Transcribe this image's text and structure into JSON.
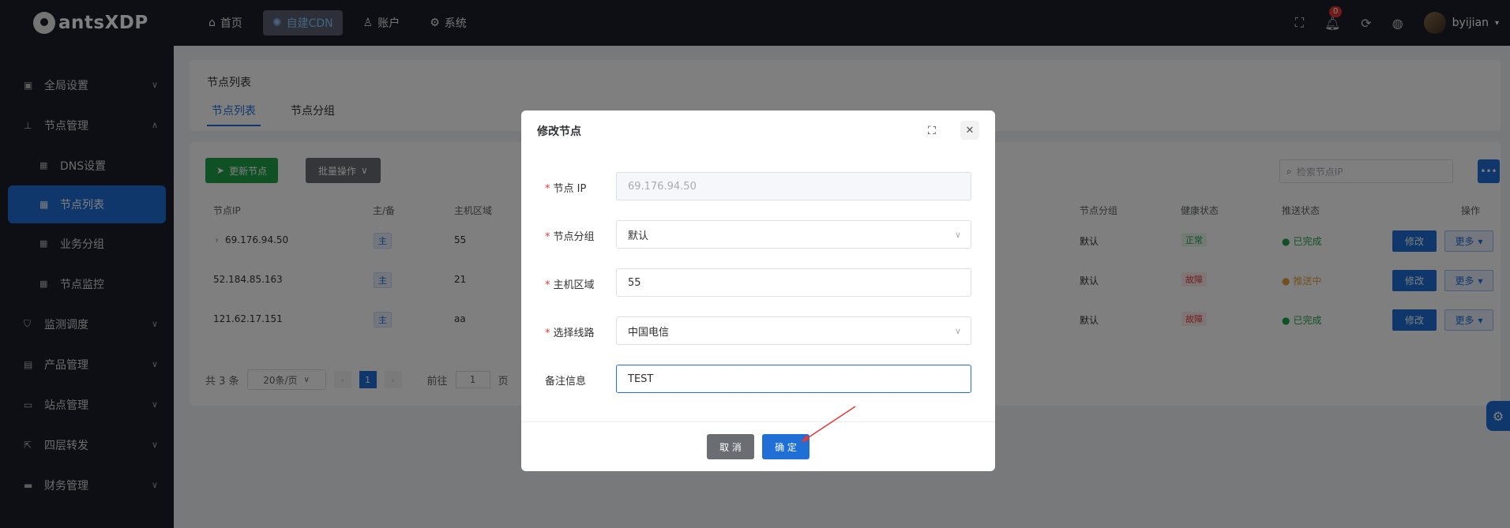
{
  "app": {
    "logo_text": "antsXDP"
  },
  "topnav": [
    {
      "icon": "home-icon",
      "glyph": "⌂",
      "label": "首页"
    },
    {
      "icon": "cdn-icon",
      "glyph": "✺",
      "label": "自建CDN"
    },
    {
      "icon": "user-icon",
      "glyph": "♙",
      "label": "账户"
    },
    {
      "icon": "gear-icon",
      "glyph": "⚙",
      "label": "系统"
    }
  ],
  "topright": {
    "notification_count": "0",
    "username": "byijian"
  },
  "sidebar": {
    "items": [
      {
        "label": "全局设置"
      },
      {
        "label": "节点管理"
      },
      {
        "label": "DNS设置"
      },
      {
        "label": "节点列表"
      },
      {
        "label": "业务分组"
      },
      {
        "label": "节点监控"
      },
      {
        "label": "监测调度"
      },
      {
        "label": "产品管理"
      },
      {
        "label": "站点管理"
      },
      {
        "label": "四层转发"
      },
      {
        "label": "财务管理"
      }
    ]
  },
  "page": {
    "title": "节点列表",
    "tabs": [
      {
        "label": "节点列表"
      },
      {
        "label": "节点分组"
      }
    ]
  },
  "toolbar": {
    "update_label": "更新节点",
    "batch_label": "批量操作",
    "search_placeholder": "检索节点IP"
  },
  "table": {
    "headers": {
      "ip": "节点IP",
      "role": "主/备",
      "region": "主机区域",
      "group": "节点分组",
      "health": "健康状态",
      "push": "推送状态",
      "ops": "操作"
    },
    "rows": [
      {
        "ip": "69.176.94.50",
        "role": "主",
        "region": "55",
        "group": "默认",
        "health": "正常",
        "push": "已完成",
        "edit": "修改",
        "more": "更多"
      },
      {
        "ip": "52.184.85.163",
        "role": "主",
        "region": "21",
        "group": "默认",
        "health": "故障",
        "push": "推送中",
        "edit": "修改",
        "more": "更多"
      },
      {
        "ip": "121.62.17.151",
        "role": "主",
        "region": "aa",
        "group": "默认",
        "health": "故障",
        "push": "已完成",
        "edit": "修改",
        "more": "更多"
      }
    ]
  },
  "pager": {
    "total": "共 3 条",
    "page_size": "20条/页",
    "current": "1",
    "goto_prefix": "前往",
    "goto_value": "1",
    "goto_suffix": "页"
  },
  "dialog": {
    "title": "修改节点",
    "fields": [
      {
        "label": "节点 IP",
        "required": true,
        "value": "69.176.94.50"
      },
      {
        "label": "节点分组",
        "required": true,
        "value": "默认"
      },
      {
        "label": "主机区域",
        "required": true,
        "value": "55"
      },
      {
        "label": "选择线路",
        "required": true,
        "value": "中国电信"
      },
      {
        "label": "备注信息",
        "required": false,
        "value": "TEST"
      }
    ],
    "cancel_label": "取 消",
    "ok_label": "确 定"
  },
  "colors": {
    "primary": "#1f6fd6",
    "success": "#1ea34b",
    "danger": "#e53935",
    "warning": "#e6a23c",
    "sidebar_bg": "#1d1f2b"
  }
}
